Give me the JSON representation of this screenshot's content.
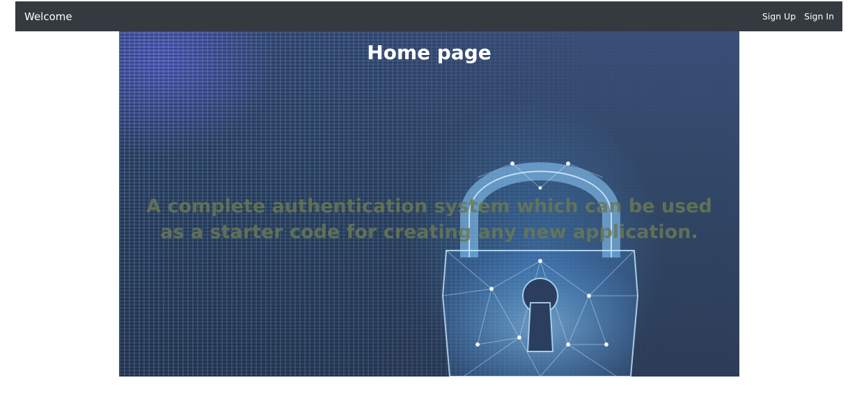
{
  "navbar": {
    "brand": "Welcome",
    "links": [
      {
        "label": "Sign Up"
      },
      {
        "label": "Sign In"
      }
    ],
    "background": "#343a40"
  },
  "hero": {
    "title": "Home page",
    "tagline": "A complete authentication system which can be used as a starter code for creating any new application.",
    "image_icon": "padlock-icon"
  }
}
